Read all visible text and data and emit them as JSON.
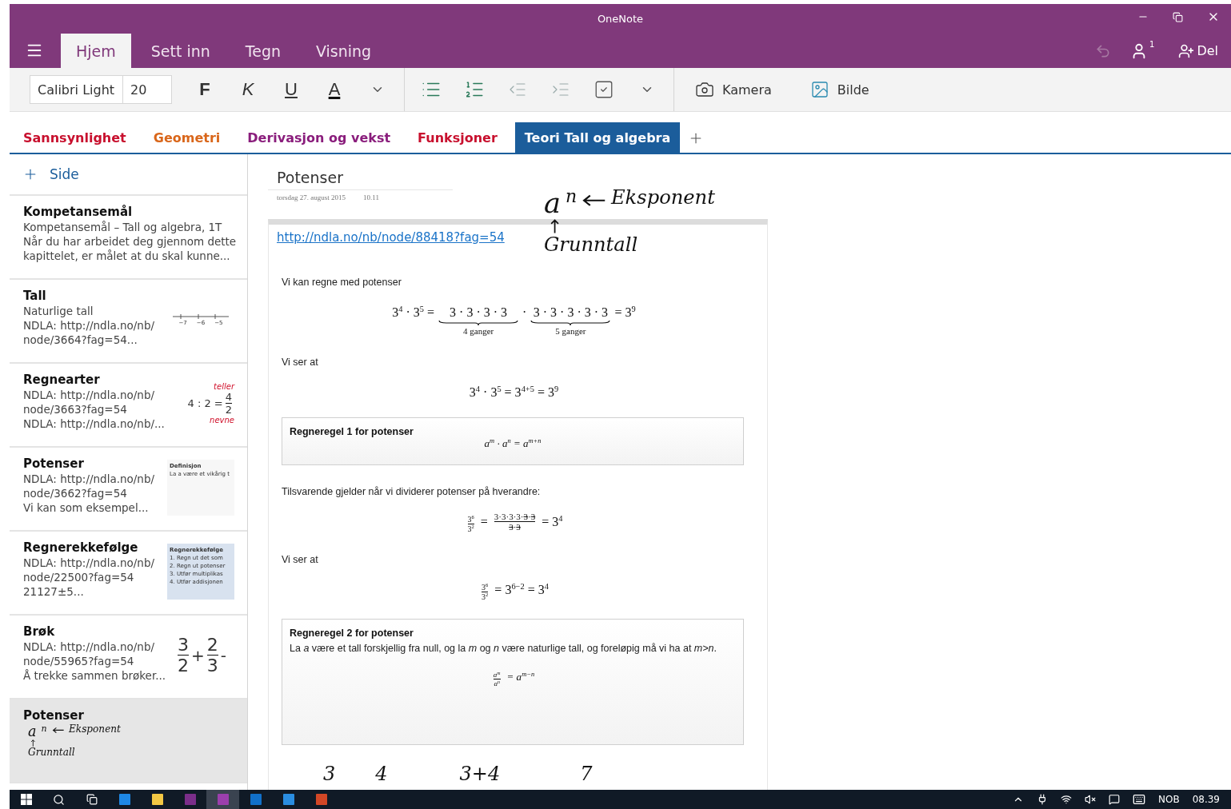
{
  "window": {
    "title": "OneNote"
  },
  "ribbon": {
    "tabs": [
      {
        "label": "Hjem",
        "selected": true
      },
      {
        "label": "Sett inn",
        "selected": false
      },
      {
        "label": "Tegn",
        "selected": false
      },
      {
        "label": "Visning",
        "selected": false
      }
    ],
    "account_badge": "1",
    "share": "Del"
  },
  "toolbar": {
    "font": "Calibri Light",
    "size": "20",
    "format_buttons": [
      {
        "label": "F",
        "kind": "bold"
      },
      {
        "label": "K",
        "kind": "italic"
      },
      {
        "label": "U",
        "kind": "underline"
      },
      {
        "label": "A",
        "kind": "color"
      }
    ],
    "camera": "Kamera",
    "picture": "Bilde"
  },
  "sections": [
    {
      "label": "Sannsynlighet",
      "color": "#c8102e",
      "selected": false
    },
    {
      "label": "Geometri",
      "color": "#d9661a",
      "selected": false
    },
    {
      "label": "Derivasjon og vekst",
      "color": "#8a1d7c",
      "selected": false
    },
    {
      "label": "Funksjoner",
      "color": "#c8102e",
      "selected": false
    },
    {
      "label": "Teori Tall og algebra",
      "color": "#1b5d9b",
      "selected": true
    }
  ],
  "pages": {
    "add_label": "Side",
    "items": [
      {
        "title": "Kompetansemål",
        "lines": [
          "Kompetansemål – Tall og algebra, 1T",
          "Når du har arbeidet deg gjennom dette",
          "kapittelet, er målet at du skal kunne..."
        ],
        "selected": false
      },
      {
        "title": "Tall",
        "lines": [
          "Naturlige tall",
          "NDLA: http://ndla.no/nb/",
          "node/3664?fag=54..."
        ],
        "selected": false,
        "thumb": {
          "kind": "number-line",
          "labels": [
            "−7",
            "−6",
            "−5"
          ]
        }
      },
      {
        "title": "Regnearter",
        "lines": [
          "NDLA: http://ndla.no/nb/",
          "node/3663?fag=54",
          "NDLA: http://ndla.no/nb/..."
        ],
        "selected": false,
        "thumb": {
          "kind": "division",
          "expr": "4 : 2 =",
          "num": "4",
          "den": "2",
          "top": "teller",
          "bottom": "nevne"
        }
      },
      {
        "title": "Potenser",
        "lines": [
          "NDLA: http://ndla.no/nb/",
          "node/3662?fag=54",
          "Vi kan som eksempel..."
        ],
        "selected": false,
        "thumb": {
          "kind": "definition-card",
          "title": "Definisjon",
          "lines": [
            "La a være et vikårig t"
          ]
        }
      },
      {
        "title": "Regnerekkefølge",
        "lines": [
          "NDLA: http://ndla.no/nb/",
          "node/22500?fag=54",
          "21127±5..."
        ],
        "selected": false,
        "thumb": {
          "kind": "list-card",
          "title": "Regnerekkefølge",
          "lines": [
            "1.  Regn ut det som",
            "2.  Regn ut potenser",
            "3.  Utfør multiplikas",
            "4.  Utfør addisjonen"
          ]
        }
      },
      {
        "title": "Brøk",
        "lines": [
          "NDLA: http://ndla.no/nb/",
          "node/55965?fag=54",
          "Å trekke sammen brøker..."
        ],
        "selected": false,
        "thumb": {
          "kind": "fraction-sum",
          "fractions": [
            {
              "num": "3",
              "den": "2"
            },
            {
              "num": "2",
              "den": "3"
            }
          ],
          "ops": [
            "+",
            "-"
          ]
        }
      },
      {
        "title": "Potenser",
        "selected": true,
        "thumb": {
          "kind": "ink",
          "base": "a",
          "exponent": "n",
          "exponent_label": "Eksponent",
          "base_label": "Grunntall"
        }
      }
    ]
  },
  "page": {
    "title": "Potenser",
    "date": "torsdag 27. august 2015",
    "time": "10.11",
    "ink": {
      "base": "a",
      "exponent": "n",
      "exponent_label": "Eksponent",
      "base_label": "Grunntall"
    },
    "link": "http://ndla.no/nb/node/88418?fag=54",
    "blocks": [
      {
        "kind": "text",
        "s": "Vi kan regne med potenser"
      },
      {
        "kind": "equation",
        "pieces": [
          {
            "kind": "text",
            "s": "3$^{4}$ · 3$^{5}$ ="
          },
          {
            "kind": "brace",
            "s": "3 · 3 · 3 · 3",
            "label": "4 ganger"
          },
          {
            "kind": "text",
            "s": "·"
          },
          {
            "kind": "brace",
            "s": "3 · 3 · 3 · 3 · 3",
            "label": "5 ganger"
          },
          {
            "kind": "text",
            "s": "= 3$^{9}$"
          }
        ]
      },
      {
        "kind": "text",
        "s": "Vi ser at"
      },
      {
        "kind": "equation",
        "pieces": [
          {
            "kind": "text",
            "s": "3$^{4}$ · 3$^{5}$ = 3$^{4+5}$ = 3$^{9}$"
          }
        ]
      },
      {
        "kind": "rule",
        "title": "Regneregel 1 for potenser",
        "formula": "a$^{m}$ · a$^{n}$ = a$^{m+n}$"
      },
      {
        "kind": "text",
        "s": "Tilsvarende gjelder når vi dividerer potenser på hverandre:"
      },
      {
        "kind": "equation",
        "pieces": [
          {
            "kind": "frac",
            "num": [
              {
                "s": "3$^{6}$",
                "struck": false
              }
            ],
            "den": [
              {
                "s": "3$^{2}$",
                "struck": false
              }
            ]
          },
          {
            "kind": "text",
            "s": "="
          },
          {
            "kind": "frac",
            "num": [
              {
                "s": "3·3·3·3·",
                "struck": false
              },
              {
                "s": "3",
                "struck": true
              },
              {
                "s": "·",
                "struck": false
              },
              {
                "s": "3",
                "struck": true
              }
            ],
            "den": [
              {
                "s": "3",
                "struck": true
              },
              {
                "s": "·",
                "struck": false
              },
              {
                "s": "3",
                "struck": true
              }
            ]
          },
          {
            "kind": "text",
            "s": "= 3$^{4}$"
          }
        ]
      },
      {
        "kind": "text",
        "s": "Vi ser at"
      },
      {
        "kind": "equation",
        "pieces": [
          {
            "kind": "frac",
            "num": [
              {
                "s": "3$^{6}$",
                "struck": false
              }
            ],
            "den": [
              {
                "s": "3$^{2}$",
                "struck": false
              }
            ]
          },
          {
            "kind": "text",
            "s": "= 3$^{6−2}$ = 3$^{4}$"
          }
        ]
      },
      {
        "kind": "rule",
        "title": "Regneregel 2 for potenser",
        "body": "La *a* være et tall forskjellig fra null, og la *m* og *n* være naturlige tall, og foreløpig må vi ha at *m>n*.",
        "formula_frac": {
          "num": "a$^{m}$",
          "den": "a$^{n}$"
        },
        "formula": "= a$^{m−n}$"
      }
    ],
    "bottom_ink": [
      "3",
      "4",
      "3+4",
      "7"
    ]
  },
  "taskbar": {
    "language": "NOB",
    "time": "08.39"
  }
}
